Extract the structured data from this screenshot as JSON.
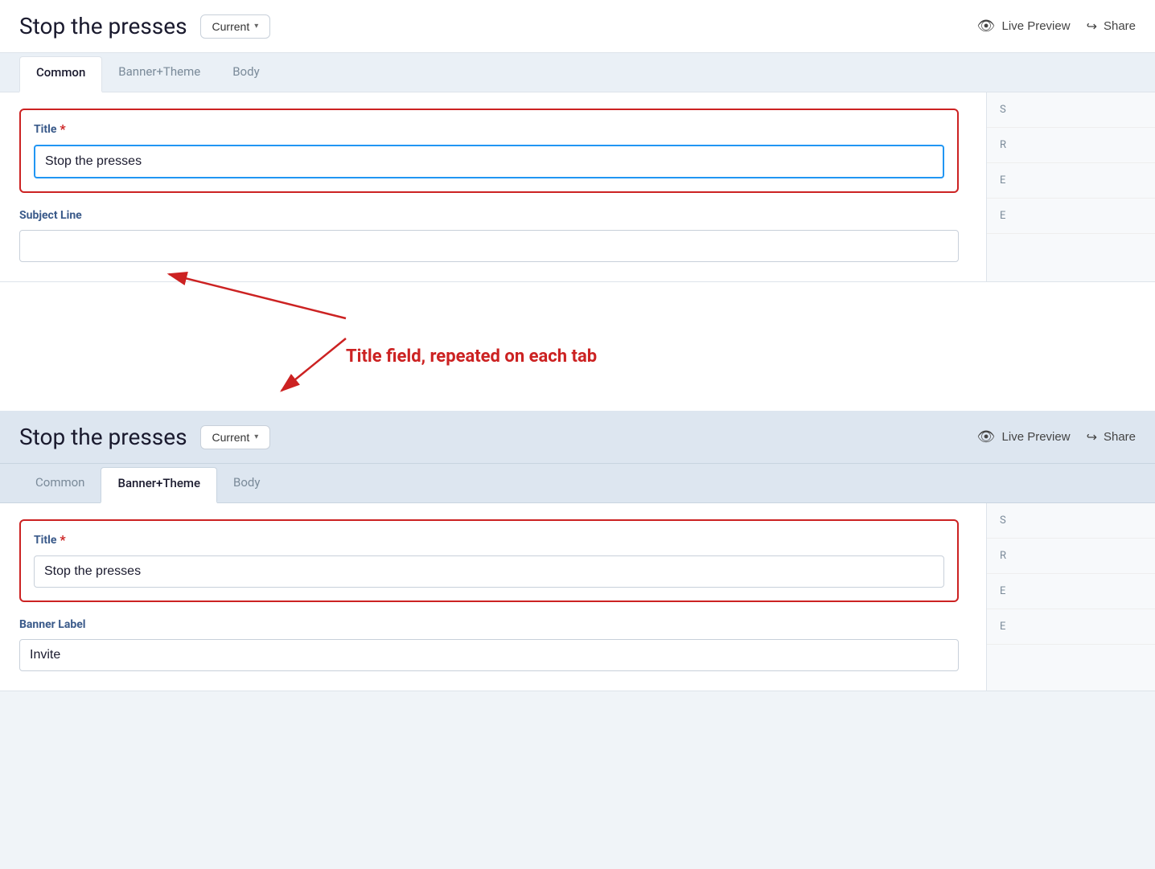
{
  "app": {
    "title": "Stop the presses"
  },
  "header": {
    "title": "Stop the presses",
    "current_label": "Current",
    "live_preview_label": "Live Preview",
    "share_label": "Share"
  },
  "tabs_top": {
    "items": [
      {
        "id": "common",
        "label": "Common",
        "active": true
      },
      {
        "id": "banner_theme",
        "label": "Banner+Theme",
        "active": false
      },
      {
        "id": "body",
        "label": "Body",
        "active": false
      }
    ]
  },
  "top_form": {
    "title_label": "Title",
    "title_required": "*",
    "title_value": "Stop the presses",
    "subject_label": "Subject Line",
    "subject_value": ""
  },
  "annotation": {
    "text": "Title field, repeated on each tab"
  },
  "tabs_bottom": {
    "items": [
      {
        "id": "common",
        "label": "Common",
        "active": false
      },
      {
        "id": "banner_theme",
        "label": "Banner+Theme",
        "active": true
      },
      {
        "id": "body",
        "label": "Body",
        "active": false
      }
    ]
  },
  "bottom_form": {
    "title_label": "Title",
    "title_required": "*",
    "title_value": "Stop the presses",
    "banner_label": "Banner Label",
    "banner_value": "Invite"
  },
  "right_sidebar_top": {
    "items": [
      "S",
      "R",
      "E",
      "E"
    ]
  },
  "right_sidebar_bottom": {
    "items": [
      "S",
      "R",
      "E",
      "E"
    ]
  }
}
